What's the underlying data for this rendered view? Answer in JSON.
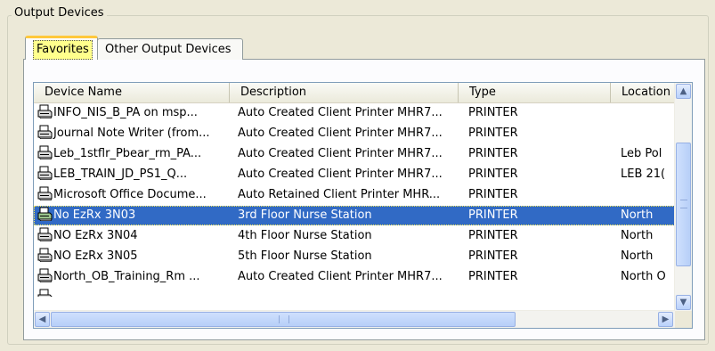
{
  "group": {
    "title": "Output Devices"
  },
  "tabs": [
    {
      "label": "Favorites",
      "selected": true
    },
    {
      "label": "Other Output Devices",
      "selected": false
    }
  ],
  "list": {
    "columns": [
      "Device Name",
      "Description",
      "Type",
      "Location"
    ],
    "rows": [
      {
        "name": "INFO_NIS_B_PA on msp...",
        "description": "Auto Created Client Printer MHR7...",
        "type": "PRINTER",
        "location": ""
      },
      {
        "name": "Journal Note Writer (from...",
        "description": "Auto Created Client Printer MHR7...",
        "type": "PRINTER",
        "location": ""
      },
      {
        "name": "Leb_1stflr_Pbear_rm_PA...",
        "description": "Auto Created Client Printer MHR7...",
        "type": "PRINTER",
        "location": "Leb Pol"
      },
      {
        "name": "LEB_TRAIN_JD_PS1_Q...",
        "description": "Auto Created Client Printer MHR7...",
        "type": "PRINTER",
        "location": "LEB 21("
      },
      {
        "name": "Microsoft Office Docume...",
        "description": "Auto Retained Client Printer MHR...",
        "type": "PRINTER",
        "location": ""
      },
      {
        "name": "No EzRx 3N03",
        "description": "3rd Floor Nurse Station",
        "type": "PRINTER",
        "location": "North",
        "selected": true
      },
      {
        "name": "NO EzRx 3N04",
        "description": "4th Floor Nurse Station",
        "type": "PRINTER",
        "location": "North"
      },
      {
        "name": "NO EzRx 3N05",
        "description": "5th Floor Nurse Station",
        "type": "PRINTER",
        "location": "North"
      },
      {
        "name": "North_OB_Training_Rm ...",
        "description": "Auto Created Client Printer MHR7...",
        "type": "PRINTER",
        "location": "North O"
      }
    ],
    "row_icon": "printer-icon"
  },
  "colors": {
    "selection": "#316ac5",
    "tab_highlight": "#ffff8c",
    "accent": "#ffc83c"
  }
}
